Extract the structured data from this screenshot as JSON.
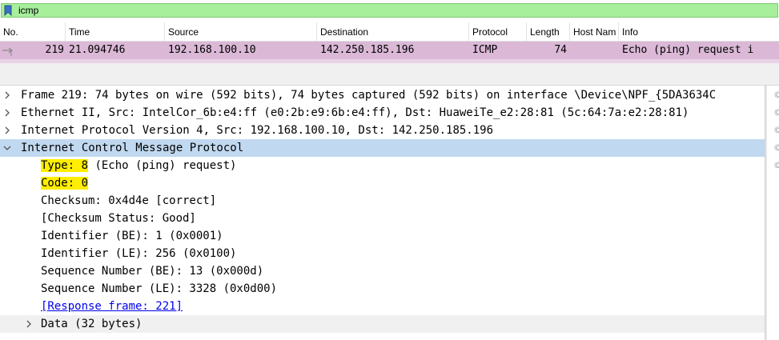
{
  "filter": {
    "value": "icmp",
    "icon": "bookmark-icon",
    "bg": "#a7ef9b"
  },
  "packet_list": {
    "columns": [
      "No.",
      "Time",
      "Source",
      "Destination",
      "Protocol",
      "Length",
      "Host Nam",
      "Info"
    ],
    "rows": [
      {
        "no": "219",
        "time": "21.094746",
        "source": "192.168.100.10",
        "destination": "142.250.185.196",
        "protocol": "ICMP",
        "length": "74",
        "host": "",
        "info": "Echo (ping) request  i"
      }
    ],
    "row_color": "#dab8d6"
  },
  "details": {
    "frame": "Frame 219: 74 bytes on wire (592 bits), 74 bytes captured (592 bits) on interface \\Device\\NPF_{5DA3634C",
    "ethernet": "Ethernet II, Src: IntelCor_6b:e4:ff (e0:2b:e9:6b:e4:ff), Dst: HuaweiTe_e2:28:81 (5c:64:7a:e2:28:81)",
    "ip": "Internet Protocol Version 4, Src: 192.168.100.10, Dst: 142.250.185.196",
    "icmp": "Internet Control Message Protocol",
    "type_label": "Type: 8",
    "type_desc": " (Echo (ping) request)",
    "code": "Code: 0",
    "checksum": "Checksum: 0x4d4e [correct]",
    "checksum_status": "[Checksum Status: Good]",
    "identifier_be": "Identifier (BE): 1 (0x0001)",
    "identifier_le": "Identifier (LE): 256 (0x0100)",
    "seq_be": "Sequence Number (BE): 13 (0x000d)",
    "seq_le": "Sequence Number (LE): 3328 (0x0d00)",
    "response_frame": "[Response frame: 221]",
    "data": "Data (32 bytes)"
  },
  "colors": {
    "selected": "#c1d9f0",
    "highlight": "#ffee00",
    "link": "#0000ee"
  }
}
